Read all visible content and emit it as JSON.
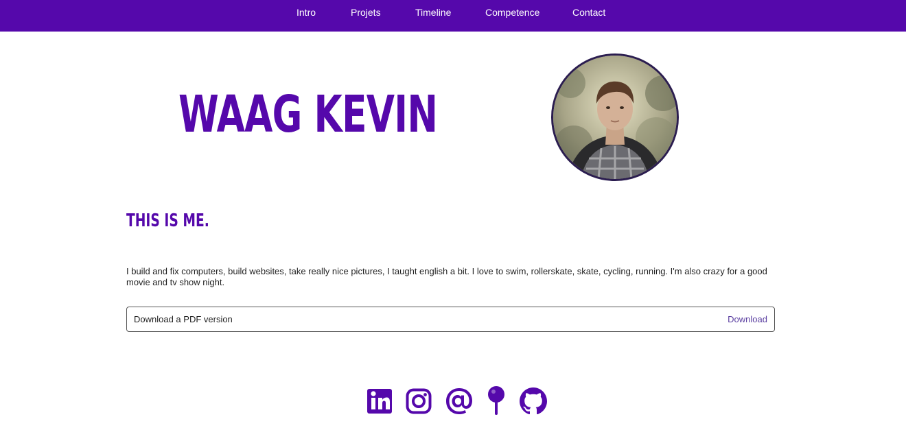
{
  "nav": {
    "items": [
      {
        "label": "Intro"
      },
      {
        "label": "Projets"
      },
      {
        "label": "Timeline"
      },
      {
        "label": "Competence"
      },
      {
        "label": "Contact"
      }
    ]
  },
  "hero": {
    "name": "WAAG KEVIN",
    "avatar_icon": "profile-photo"
  },
  "about": {
    "title": "THIS IS ME.",
    "bio": "I build and fix computers, build websites, take really nice pictures, I taught english a bit. I love to swim, rollerskate, skate, cycling, running. I'm also crazy for a good movie and tv show night."
  },
  "pdf": {
    "label": "Download a PDF version",
    "link_label": "Download"
  },
  "social": {
    "icons": [
      "linkedin-icon",
      "instagram-icon",
      "email-icon",
      "location-pin-icon",
      "github-icon"
    ]
  },
  "colors": {
    "brand": "#5508ab",
    "nav_text": "#ffffff",
    "link": "#5a3ea0"
  }
}
